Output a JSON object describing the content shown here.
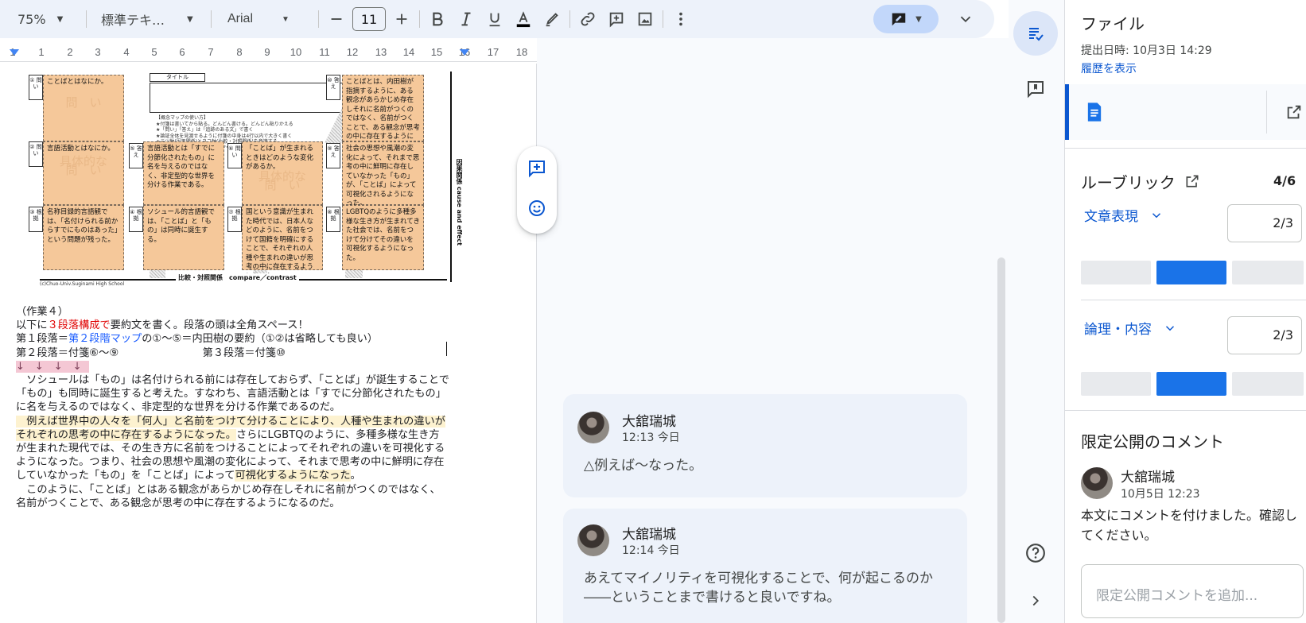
{
  "toolbar": {
    "zoom": "75%",
    "style": "標準テキ…",
    "font": "Arial",
    "font_size": "11"
  },
  "ruler": {
    "numbers": [
      "1",
      "1",
      "2",
      "3",
      "4",
      "5",
      "6",
      "7",
      "8",
      "9",
      "10",
      "11",
      "12",
      "13",
      "14",
      "15",
      "16",
      "17",
      "18"
    ]
  },
  "worksheet": {
    "title_label": "タイトル",
    "nums": {
      "n1": "① 問い",
      "n2": "② 問い",
      "n3": "③ 根拠",
      "n4": "④ 根拠",
      "n5": "⑤ 答え",
      "n6": "⑥ 問い",
      "n7": "⑦ 根拠",
      "n8": "⑧ 根拠",
      "n9": "⑨ 答え",
      "n10": "⑩ 答え"
    },
    "cards": {
      "c1": "ことばとはなにか。",
      "c2": "言語活動とはなにか。",
      "c3": "名称目録的言語観では、「名付けられる前からすでにものはあった」という問題が残った。",
      "c4": "ソシュール的言語観では、「ことば」と「もの」は同時に誕生する。",
      "c5": "言語活動とは「すでに分節化されたもの」に名を与えるのではなく、非定型的な世界を分ける作業である。",
      "c6": "「ことば」が生まれるときはどのような変化があるか。",
      "c7": "国という意識が生まれた時代では、日本人などのように、名前をつけて国籍を明確にすることで、それぞれの人種や生まれの違いが思考の中に存在するようになった。",
      "c8": "LGBTQのように多種多様な生き方が生まれてきた社会では、名前をつけて分けてその違いを可視化するようになった。",
      "c9": "社会の思想や風潮の変化によって、それまで思考の中に鮮明に存在していなかった「もの」が、「ことば」によって可視化されるようになった。",
      "c10": "ことばとは、内田樹が指摘するように、ある観念があらかじめ存在しそれに名前がつくのではなく、名前がつくことで、ある観念が思考の中に存在するようになるのだ。"
    },
    "ghosts": {
      "g1": "問　い",
      "g2": "具体的な\n問　い",
      "g6": "具体的な\n問　い"
    },
    "notes": "【概念マップの使い方】\n★付箋は書いてから貼る。どんどん書ける。どんどん貼りかえる\n★「問い」「答え」は「追跡のある文」で書く\n★論証全体を見渡せるように付箋の中身は4行以内で大きく書く\n★テツ軸(因果関係)とヨコ軸(比較・対照関係)を意識する\n★①〜⑩を順番につなげば論のアウトラインが見える！",
    "vaxis": "因果関係 cause and effect",
    "haxis": "比較・対照関係　compare／contrast",
    "copyright": "(c)Chuo-Univ.Suginami High School"
  },
  "doc": {
    "l1": "（作業４）",
    "l2a": "以下に",
    "l2b": "３段落構成で",
    "l2c": "要約文を書く。段落の頭は全角スペース！",
    "l3a": "第１段落＝",
    "l3b": "第２段階マップ",
    "l3c": "の①〜⑤＝内田樹の要約（①②は省略しても良い）",
    "l4": "第２段落＝付箋⑥〜⑨　　　　　　　　第３段落＝付箋⑩",
    "arrows": "↓　↓　↓　↓",
    "p1": "　ソシュールは「もの」は名付けられる前には存在しておらず、「ことば」が誕生することで「もの」も同時に誕生すると考えた。すなわち、言語活動とは「すでに分節化されたもの」に名を与えるのではなく、非定型的な世界を分ける作業であるのだ。",
    "p2a": "　例えば世界中の人々を「何人」と名前をつけて分けることにより、人種や生まれの違いがそれぞれの思考の中に存在するようになった。",
    "p2b": "さらにLGBTQのように、多種多様な生き方が生まれた現代では、その生き方に名前をつけることによってそれぞれの違いを可視化するようになった。つまり、社会の思想や風潮の変化によって、それまで思考の中に鮮明に存在していなかった「もの」を「ことば」によって",
    "p2c": "可視化するようになった",
    "p2d": "。",
    "p3": "　このように、「ことば」とはある観念があらかじめ存在しそれに名前がつくのではなく、名前がつくことで、ある観念が思考の中に存在するようになるのだ。"
  },
  "comments": [
    {
      "author": "大舘瑞城",
      "time": "12:13 今日",
      "body": "△例えば〜なった。"
    },
    {
      "author": "大舘瑞城",
      "time": "12:14 今日",
      "body": "あえてマイノリティを可視化することで、何が起こるのか――ということまで書けると良いですね。"
    }
  ],
  "panel": {
    "title": "ファイル",
    "submitted": "提出日時: 10月3日 14:29",
    "history_link": "履歴を表示",
    "rubric_title": "ルーブリック",
    "rubric_total": "4/6",
    "criteria": [
      {
        "name": "文章表現",
        "score": "2/3",
        "selected_level": 2,
        "levels": 3
      },
      {
        "name": "論理・内容",
        "score": "2/3",
        "selected_level": 2,
        "levels": 3
      }
    ],
    "private_title": "限定公開のコメント",
    "private_author": "大舘瑞城",
    "private_time": "10月5日 12:23",
    "private_body": "本文にコメントを付けました。確認してください。",
    "private_placeholder": "限定公開コメントを追加..."
  },
  "colors": {
    "accent": "#0b57d0",
    "card": "#f5c89a",
    "highlight": "#fdf2d0",
    "red_text": "#e00000",
    "blue_text": "#1a5cff"
  }
}
